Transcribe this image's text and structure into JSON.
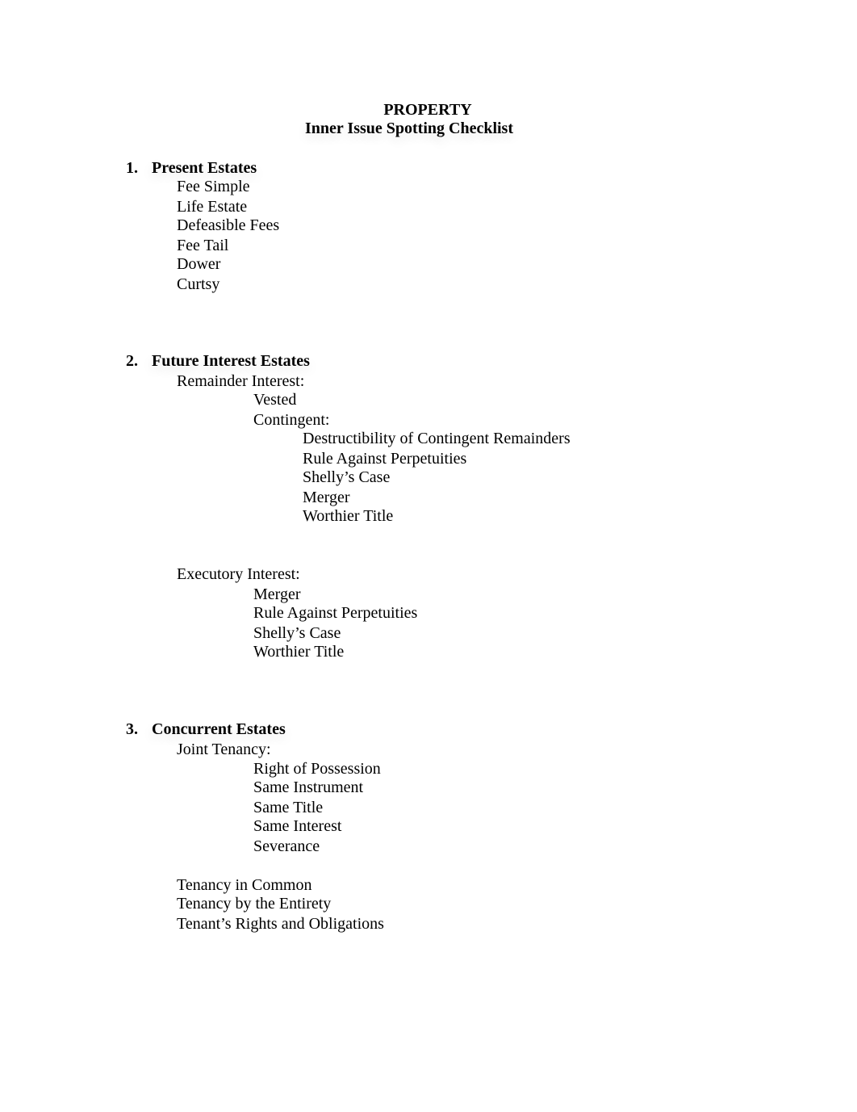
{
  "title": "PROPERTY",
  "subtitle": "Inner Issue Spotting Checklist",
  "sections": [
    {
      "number": "1.",
      "heading": "Present Estates",
      "items": [
        "Fee Simple",
        "Life Estate",
        "Defeasible Fees",
        "Fee Tail",
        "Dower",
        "Curtsy"
      ]
    },
    {
      "number": "2.",
      "heading": "Future Interest Estates",
      "remainder": {
        "label": "Remainder Interest:",
        "vested": "Vested",
        "contingent": {
          "label": "Contingent:",
          "items": [
            "Destructibility of Contingent Remainders",
            "Rule Against Perpetuities",
            "Shelly’s Case",
            "Merger",
            "Worthier Title"
          ]
        }
      },
      "executory": {
        "label": "Executory Interest:",
        "items": [
          "Merger",
          "Rule Against Perpetuities",
          "Shelly’s Case",
          "Worthier Title"
        ]
      }
    },
    {
      "number": "3.",
      "heading": "Concurrent Estates",
      "joint": {
        "label": "Joint Tenancy:",
        "items": [
          "Right of Possession",
          "Same Instrument",
          "Same Title",
          "Same Interest",
          "Severance"
        ]
      },
      "items": [
        "Tenancy in Common",
        "Tenancy by the Entirety",
        "Tenant’s Rights and Obligations"
      ]
    }
  ]
}
